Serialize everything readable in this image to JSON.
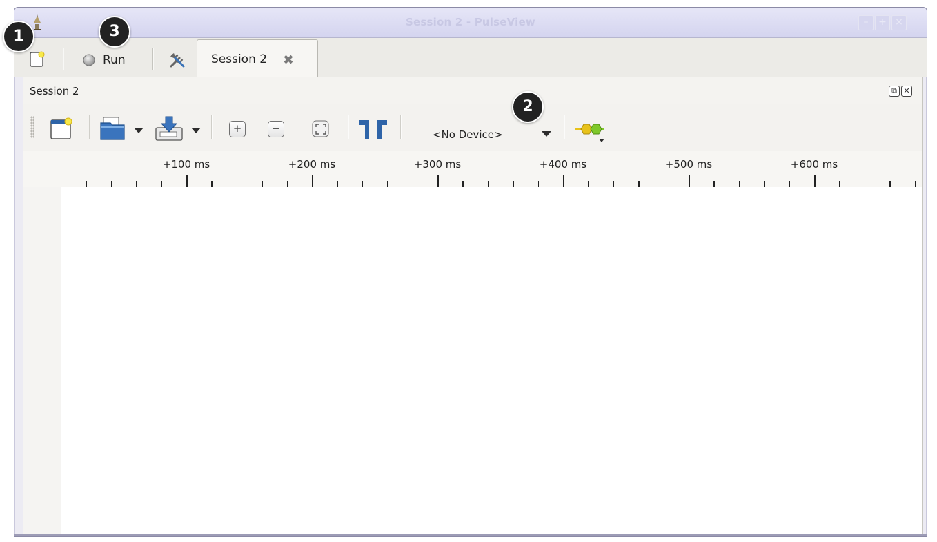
{
  "window": {
    "title": "Session 2 - PulseView",
    "buttons": {
      "minimize": "–",
      "maximize": "+",
      "close": "×"
    }
  },
  "topbar": {
    "run_label": "Run",
    "tab_label": "Session 2",
    "tab_close": "✖"
  },
  "session": {
    "title": "Session 2",
    "float_symbol": "⧉",
    "close_symbol": "✕"
  },
  "toolbar": {
    "device_label": "<No Device>",
    "icons": [
      "new-view-icon",
      "open-file-icon",
      "save-file-icon",
      "zoom-in-icon",
      "zoom-out-icon",
      "zoom-fit-icon",
      "cursor-icon",
      "decoder-icon"
    ]
  },
  "ruler": {
    "labels": [
      "+100 ms",
      "+200 ms",
      "+300 ms",
      "+400 ms",
      "+500 ms",
      "+600 ms"
    ]
  },
  "annotations": [
    "1",
    "2",
    "3"
  ],
  "colors": {
    "titlebar": "#d4d4ef",
    "title_text": "#c8c8e4",
    "accent_blue": "#2e64a8",
    "decoder_green": "#7ec82a",
    "decoder_yellow": "#e8c21a"
  }
}
